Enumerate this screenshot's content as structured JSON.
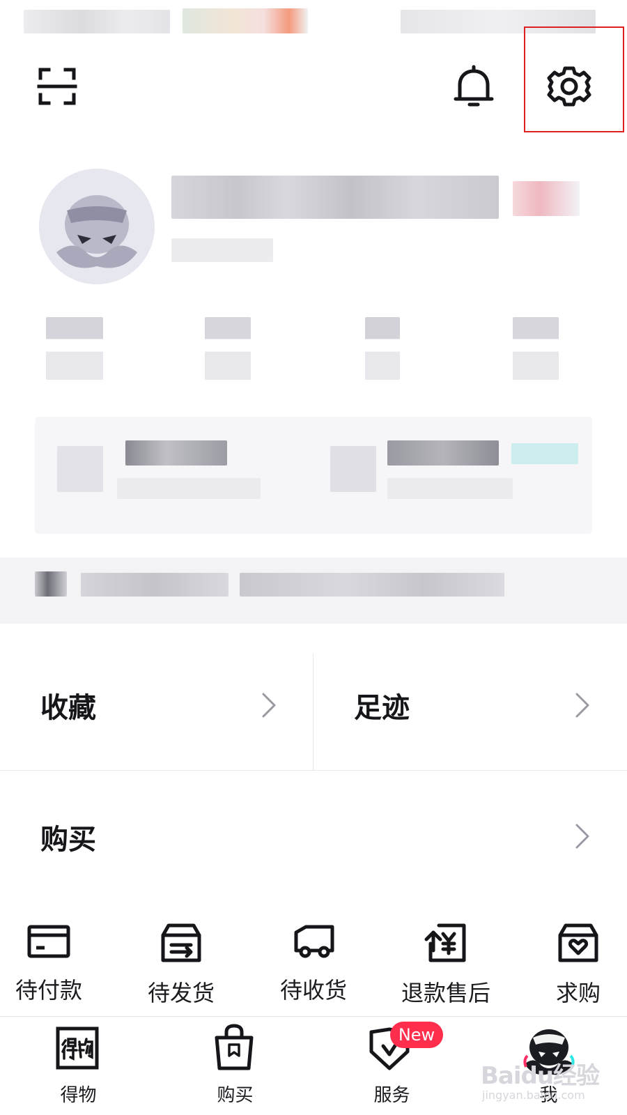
{
  "menu": {
    "favorites_label": "收藏",
    "history_label": "足迹",
    "purchase_label": "购买"
  },
  "orders": [
    {
      "label": "待付款",
      "icon": "card-icon"
    },
    {
      "label": "待发货",
      "icon": "package-icon"
    },
    {
      "label": "待收货",
      "icon": "truck-icon"
    },
    {
      "label": "退款售后",
      "icon": "refund-icon"
    },
    {
      "label": "求购",
      "icon": "wishlist-box-icon"
    }
  ],
  "bottom_nav": [
    {
      "label": "得物",
      "icon": "dewu-logo-icon"
    },
    {
      "label": "购买",
      "icon": "shopping-bag-icon"
    },
    {
      "label": "服务",
      "icon": "shield-check-icon"
    },
    {
      "label": "我",
      "icon": "mascot-avatar-icon"
    }
  ],
  "badges": {
    "service_new": "New"
  },
  "watermark": {
    "main": "Baidu经验",
    "sub": "jingyan.baidu.com"
  },
  "colors": {
    "highlight": "#e02020",
    "badge": "#ff2e4d",
    "text": "#16161a"
  }
}
